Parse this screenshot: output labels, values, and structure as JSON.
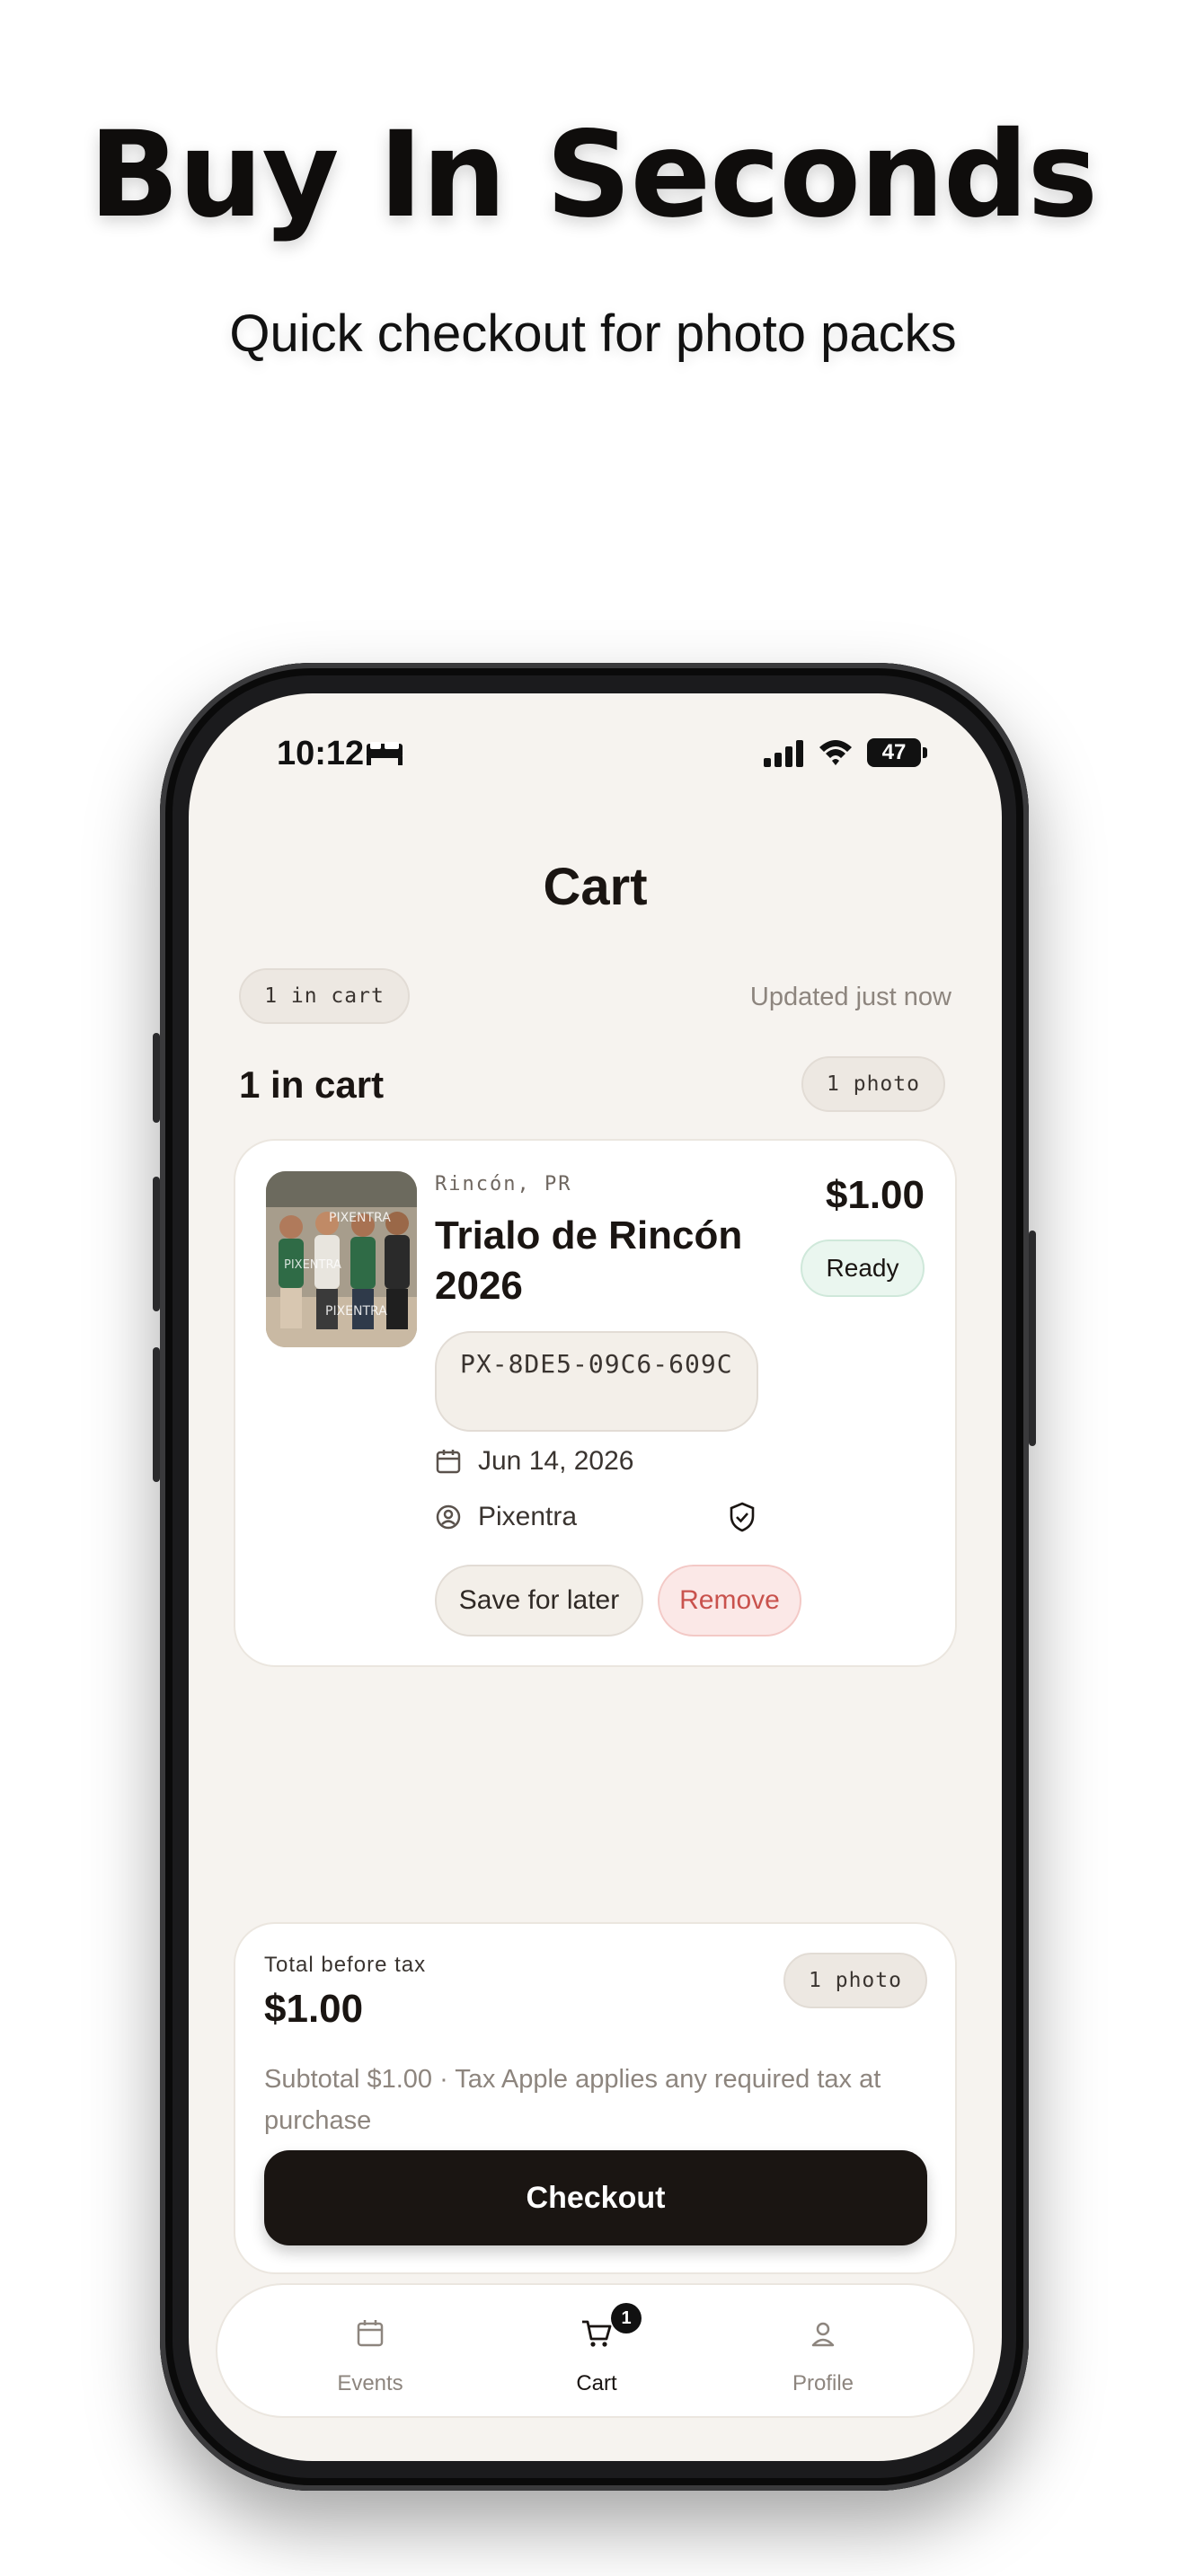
{
  "hero": {
    "title": "Buy In Seconds",
    "subtitle": "Quick checkout for photo packs"
  },
  "status_bar": {
    "time": "10:12",
    "battery": "47",
    "icons": [
      "bed-icon",
      "signal-icon",
      "wifi-icon",
      "battery-icon"
    ]
  },
  "page": {
    "title": "Cart",
    "cart_count_pill": "1 in cart",
    "updated": "Updated just now",
    "section_title": "1 in cart",
    "photo_count_pill": "1 photo"
  },
  "cart_item": {
    "location": "Rincón, PR",
    "event_name": "Trialo de Rincón 2026",
    "price": "$1.00",
    "status": "Ready",
    "code": "PX-8DE5-09C6-609C",
    "date": "Jun 14, 2026",
    "photographer": "Pixentra",
    "save_label": "Save for later",
    "remove_label": "Remove",
    "status_color": "#eaf6ef",
    "remove_color": "#c9524d"
  },
  "summary": {
    "label": "Total before tax",
    "total": "$1.00",
    "photo_count_pill": "1 photo",
    "note": "Subtotal $1.00 · Tax Apple applies any required tax at purchase",
    "checkout_label": "Checkout",
    "button_color": "#1a1512"
  },
  "tabbar": {
    "tabs": [
      {
        "label": "Events",
        "icon": "calendar-icon",
        "active": false
      },
      {
        "label": "Cart",
        "icon": "cart-icon",
        "active": true,
        "badge": "1"
      },
      {
        "label": "Profile",
        "icon": "person-icon",
        "active": false
      }
    ]
  },
  "colors": {
    "screen_bg": "#f6f3ef",
    "text_primary": "#1a1512",
    "text_muted": "#8d857e"
  }
}
